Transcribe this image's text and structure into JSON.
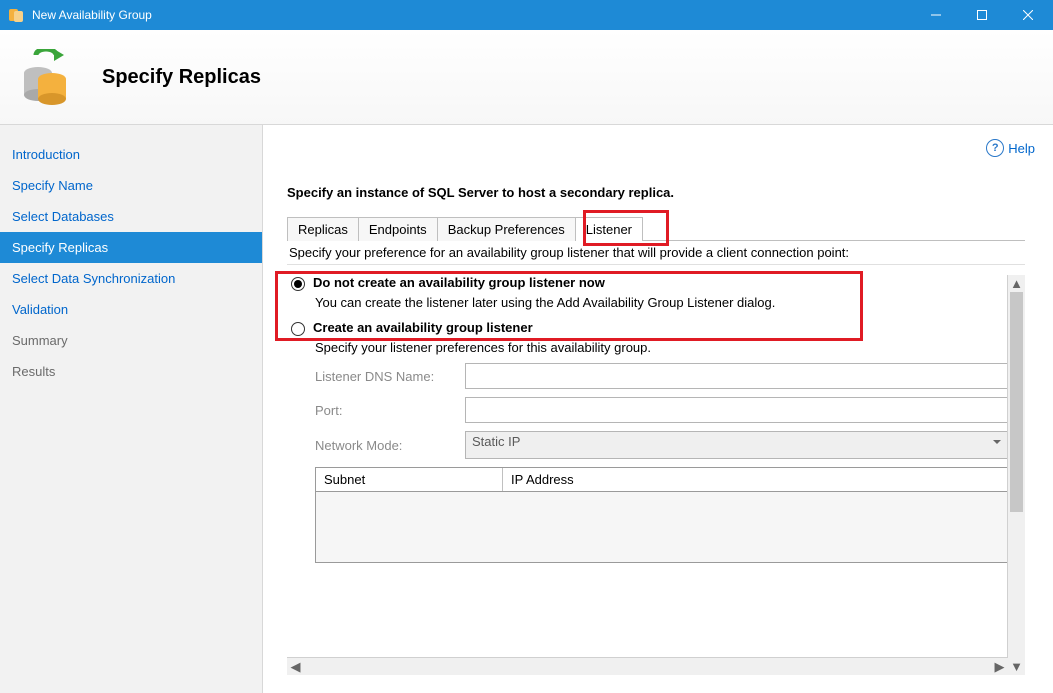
{
  "window": {
    "title": "New Availability Group"
  },
  "header": {
    "page_title": "Specify Replicas"
  },
  "nav": {
    "items": [
      {
        "label": "Introduction",
        "state": "link"
      },
      {
        "label": "Specify Name",
        "state": "link"
      },
      {
        "label": "Select Databases",
        "state": "link"
      },
      {
        "label": "Specify Replicas",
        "state": "selected"
      },
      {
        "label": "Select Data Synchronization",
        "state": "link"
      },
      {
        "label": "Validation",
        "state": "link"
      },
      {
        "label": "Summary",
        "state": "muted"
      },
      {
        "label": "Results",
        "state": "muted"
      }
    ]
  },
  "help": {
    "label": "Help"
  },
  "main": {
    "instruction": "Specify an instance of SQL Server to host a secondary replica.",
    "tabs": [
      "Replicas",
      "Endpoints",
      "Backup Preferences",
      "Listener"
    ],
    "active_tab": "Listener",
    "preference_line": "Specify your preference for an availability group listener that will provide a client connection point:",
    "option_no_listener": {
      "title": "Do not create an availability group listener now",
      "desc": "You can create the listener later using the Add Availability Group Listener dialog.",
      "selected": true
    },
    "option_create_listener": {
      "title": "Create an availability group listener",
      "desc": "Specify your listener preferences for this availability group.",
      "selected": false
    },
    "form": {
      "dns_label": "Listener DNS Name:",
      "dns_value": "",
      "port_label": "Port:",
      "port_value": "",
      "mode_label": "Network Mode:",
      "mode_value": "Static IP"
    },
    "grid": {
      "col_subnet": "Subnet",
      "col_ip": "IP Address"
    }
  }
}
